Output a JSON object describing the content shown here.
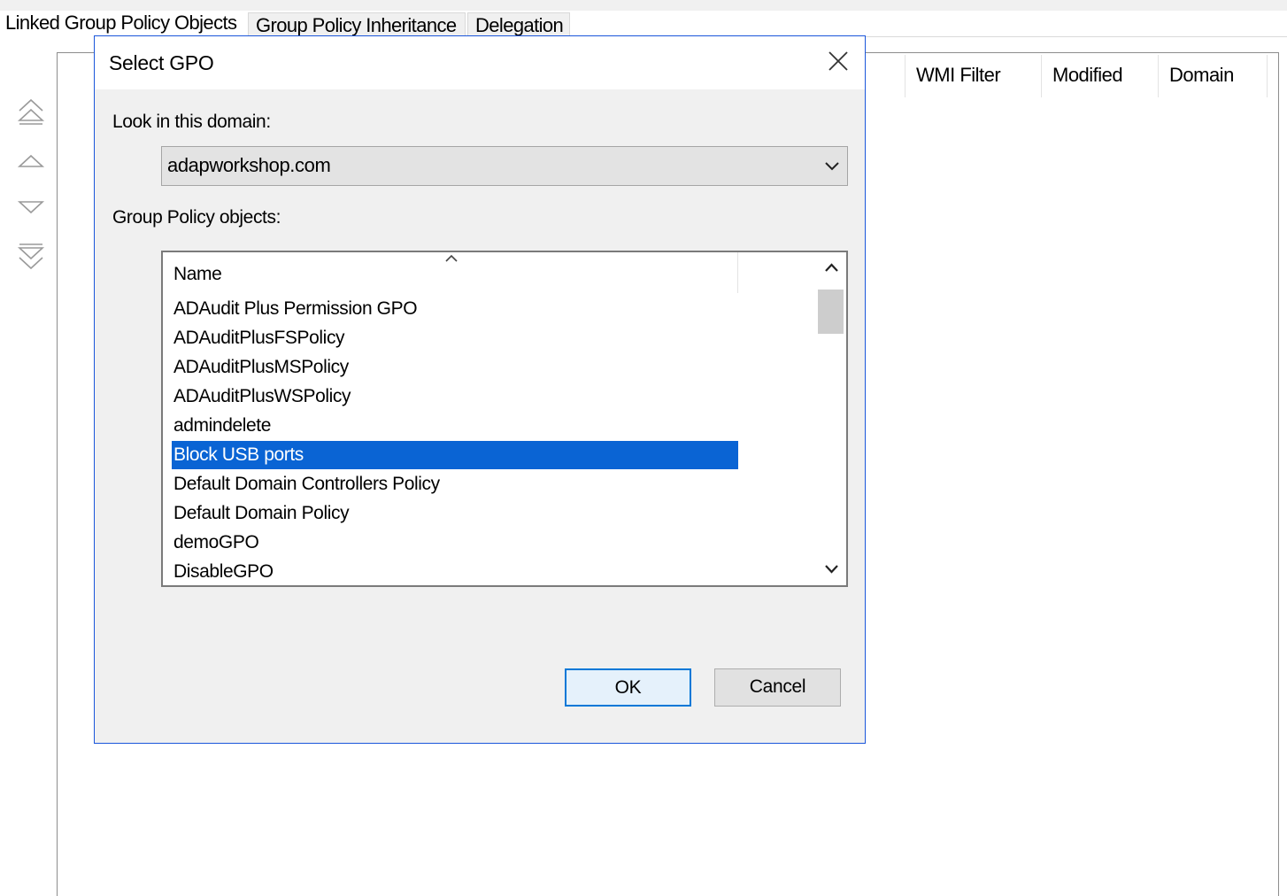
{
  "tabs": {
    "linked": "Linked Group Policy Objects",
    "inheritance": "Group Policy Inheritance",
    "delegation": "Delegation"
  },
  "background_columns": {
    "wmi_filter": "WMI Filter",
    "modified": "Modified",
    "domain": "Domain"
  },
  "side_buttons": [
    "move-to-top-icon",
    "move-up-icon",
    "move-down-icon",
    "move-to-bottom-icon"
  ],
  "dialog": {
    "title": "Select GPO",
    "domain_label": "Look in this domain:",
    "domain_value": "adapworkshop.com",
    "gpo_label": "Group Policy objects:",
    "column_name": "Name",
    "items": [
      "ADAudit Plus Permission GPO",
      "ADAuditPlusFSPolicy",
      "ADAuditPlusMSPolicy",
      "ADAuditPlusWSPolicy",
      "admindelete",
      "Block USB ports",
      "Default Domain Controllers Policy",
      "Default Domain Policy",
      "demoGPO",
      "DisableGPO"
    ],
    "selected_index": 5,
    "ok_label": "OK",
    "cancel_label": "Cancel"
  },
  "colors": {
    "selection": "#0a64d4",
    "dialog_border": "#1a56db",
    "dialog_body": "#f0f0f0",
    "default_button_border": "#0078d7"
  }
}
